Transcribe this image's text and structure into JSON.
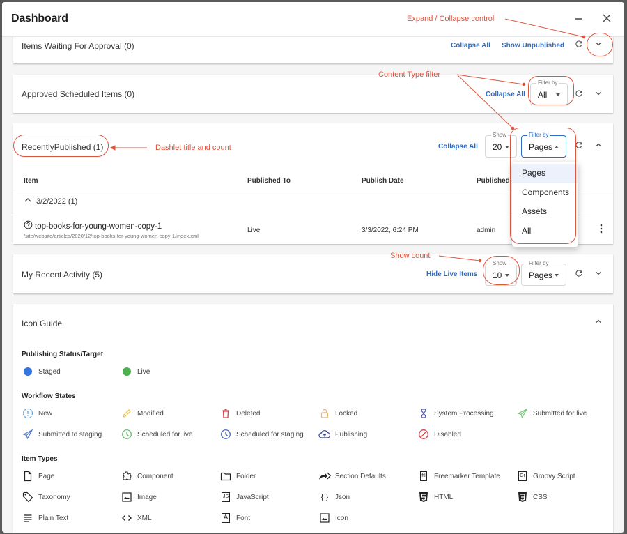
{
  "window": {
    "title": "Dashboard",
    "minimize_icon": "minimize-icon",
    "close_icon": "close-icon"
  },
  "dashlets": {
    "approval": {
      "title": "Items Waiting For Approval (0)",
      "collapse_all": "Collapse All",
      "show_unpublished": "Show Unpublished"
    },
    "scheduled": {
      "title": "Approved Scheduled Items (0)",
      "collapse_all": "Collapse All",
      "filter_label": "Filter by",
      "filter_value": "All"
    },
    "recent_published": {
      "title": "RecentlyPublished (1)",
      "collapse_all": "Collapse All",
      "show_label": "Show",
      "show_value": "20",
      "filter_label": "Filter by",
      "filter_value": "Pages",
      "filter_options": [
        "Pages",
        "Components",
        "Assets",
        "All"
      ],
      "columns": [
        "Item",
        "Published To",
        "Publish Date",
        "Published By"
      ],
      "group": {
        "label": "3/2/2022 (1)"
      },
      "rows": [
        {
          "name": "top-books-for-young-women-copy-1",
          "path": "/site/website/articles/2020/12/top-books-for-young-women-copy-1/index.xml",
          "published_to": "Live",
          "publish_date": "3/3/2022, 6:24 PM",
          "published_by": "admin"
        }
      ]
    },
    "recent_activity": {
      "title": "My Recent Activity (5)",
      "hide_live": "Hide Live Items",
      "show_label": "Show",
      "show_value": "10",
      "filter_label": "Filter by",
      "filter_value": "Pages"
    },
    "icon_guide": {
      "title": "Icon Guide",
      "publishing_heading": "Publishing Status/Target",
      "publishing": [
        {
          "label": "Staged",
          "icon": "staged-dot-icon",
          "color": "#3575e0"
        },
        {
          "label": "Live",
          "icon": "live-dot-icon",
          "color": "#4cb050"
        }
      ],
      "workflow_heading": "Workflow States",
      "workflow": [
        {
          "label": "New",
          "icon": "new-icon"
        },
        {
          "label": "Modified",
          "icon": "pencil-icon"
        },
        {
          "label": "Deleted",
          "icon": "trash-icon"
        },
        {
          "label": "Locked",
          "icon": "lock-icon"
        },
        {
          "label": "System Processing",
          "icon": "hourglass-icon"
        },
        {
          "label": "Submitted for live",
          "icon": "paper-plane-live-icon"
        },
        {
          "label": "Submitted to staging",
          "icon": "paper-plane-staging-icon"
        },
        {
          "label": "Scheduled for live",
          "icon": "clock-live-icon"
        },
        {
          "label": "Scheduled for staging",
          "icon": "clock-staging-icon"
        },
        {
          "label": "Publishing",
          "icon": "cloud-upload-icon"
        },
        {
          "label": "Disabled",
          "icon": "disabled-icon"
        }
      ],
      "types_heading": "Item Types",
      "types": [
        {
          "label": "Page",
          "icon": "page-icon"
        },
        {
          "label": "Component",
          "icon": "component-icon"
        },
        {
          "label": "Folder",
          "icon": "folder-icon"
        },
        {
          "label": "Section Defaults",
          "icon": "section-defaults-icon"
        },
        {
          "label": "Freemarker Template",
          "icon": "freemarker-icon",
          "glyph": "ftl"
        },
        {
          "label": "Groovy Script",
          "icon": "groovy-icon",
          "glyph": "Gr"
        },
        {
          "label": "Taxonomy",
          "icon": "tag-icon"
        },
        {
          "label": "Image",
          "icon": "image-icon"
        },
        {
          "label": "JavaScript",
          "icon": "javascript-icon",
          "glyph": "JS"
        },
        {
          "label": "Json",
          "icon": "json-icon",
          "glyph": "{ }"
        },
        {
          "label": "HTML",
          "icon": "html5-icon",
          "glyph": "5"
        },
        {
          "label": "CSS",
          "icon": "css3-icon",
          "glyph": "3"
        },
        {
          "label": "Plain Text",
          "icon": "text-lines-icon"
        },
        {
          "label": "XML",
          "icon": "code-icon",
          "glyph": "< >"
        },
        {
          "label": "Font",
          "icon": "font-icon",
          "glyph": "A"
        },
        {
          "label": "Icon",
          "icon": "icon-file-icon"
        }
      ]
    }
  },
  "annotations": {
    "expand_collapse": "Expand / Collapse control",
    "content_type_filter": "Content Type filter",
    "dashlet_title": "Dashlet title and count",
    "show_count": "Show count"
  },
  "colors": {
    "link": "#2f6bc3",
    "annotation": "#e0533d",
    "staged": "#3575e0",
    "live": "#4cb050"
  }
}
